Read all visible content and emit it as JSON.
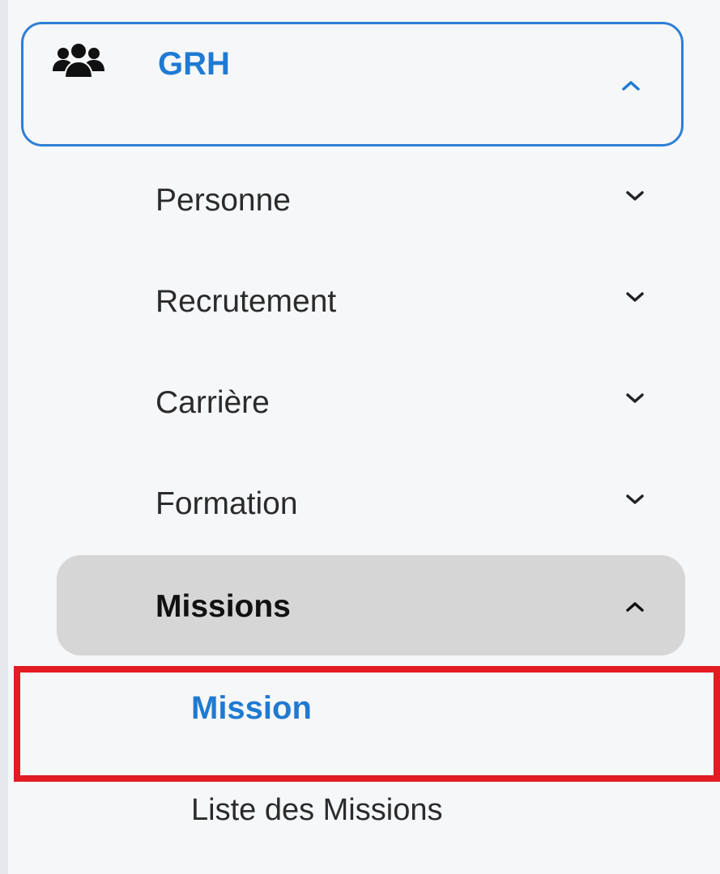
{
  "sidebar": {
    "grh": {
      "label": "GRH",
      "icon": "users-group-icon",
      "expanded": true,
      "accent_color": "#1f7ad2"
    },
    "items": [
      {
        "label": "Personne",
        "expanded": false
      },
      {
        "label": "Recrutement",
        "expanded": false
      },
      {
        "label": "Carrière",
        "expanded": false
      },
      {
        "label": "Formation",
        "expanded": false
      }
    ],
    "missions": {
      "label": "Missions",
      "expanded": true,
      "children": [
        {
          "label": "Mission",
          "active": true
        },
        {
          "label": "Liste des Missions",
          "active": false
        }
      ]
    },
    "highlight_color": "#e31b23"
  }
}
